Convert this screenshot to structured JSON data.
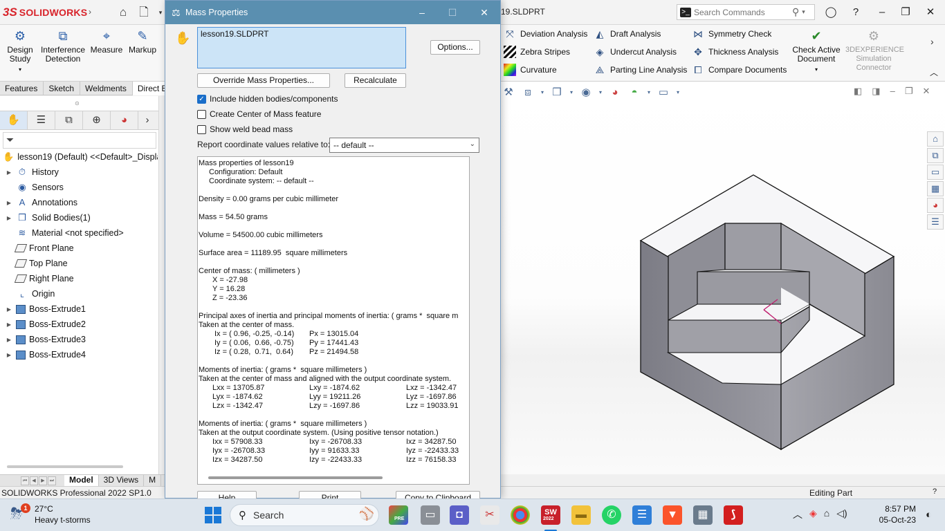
{
  "app": {
    "brand_ds": "3S",
    "brand_name": "SOLIDWORKS",
    "doc_title": "19.SLDPRT",
    "search_placeholder": "Search Commands"
  },
  "command_manager": {
    "big_buttons": [
      {
        "label": "Design\nStudy",
        "icon": "design-study-icon"
      },
      {
        "label": "Interference\nDetection",
        "icon": "interference-icon"
      },
      {
        "label": "Measure",
        "icon": "measure-icon"
      },
      {
        "label": "Markup",
        "icon": "markup-icon"
      }
    ],
    "col1": [
      "Deviation Analysis",
      "Zebra Stripes",
      "Curvature"
    ],
    "col2": [
      "Draft Analysis",
      "Undercut Analysis",
      "Parting Line Analysis"
    ],
    "col3": [
      "Symmetry Check",
      "Thickness Analysis",
      "Compare Documents"
    ],
    "check_active": "Check Active\nDocument",
    "experience": "3DEXPERIENCE\nSimulation\nConnector"
  },
  "cm_tabs": [
    "Features",
    "Sketch",
    "Weldments",
    "Direct E"
  ],
  "feature_tree": {
    "root": "lesson19 (Default) <<Default>_Display",
    "items": [
      {
        "label": "History",
        "expand": true,
        "icon": "history-icon"
      },
      {
        "label": "Sensors",
        "expand": false,
        "icon": "sensors-icon"
      },
      {
        "label": "Annotations",
        "expand": true,
        "icon": "annotations-icon"
      },
      {
        "label": "Solid Bodies(1)",
        "expand": true,
        "icon": "solid-bodies-icon"
      },
      {
        "label": "Material <not specified>",
        "expand": false,
        "icon": "material-icon"
      },
      {
        "label": "Front Plane",
        "expand": false,
        "icon": "plane-icon"
      },
      {
        "label": "Top Plane",
        "expand": false,
        "icon": "plane-icon"
      },
      {
        "label": "Right Plane",
        "expand": false,
        "icon": "plane-icon"
      },
      {
        "label": "Origin",
        "expand": false,
        "icon": "origin-icon"
      },
      {
        "label": "Boss-Extrude1",
        "expand": true,
        "icon": "extrude-icon"
      },
      {
        "label": "Boss-Extrude2",
        "expand": true,
        "icon": "extrude-icon"
      },
      {
        "label": "Boss-Extrude3",
        "expand": true,
        "icon": "extrude-icon"
      },
      {
        "label": "Boss-Extrude4",
        "expand": true,
        "icon": "extrude-icon"
      }
    ]
  },
  "bottom_tabs": [
    "Model",
    "3D Views",
    "M"
  ],
  "status": {
    "left": "SOLIDWORKS Professional 2022 SP1.0",
    "right": "Editing Part"
  },
  "dialog": {
    "title": "Mass Properties",
    "selection": "lesson19.SLDPRT",
    "options_btn": "Options...",
    "override_btn": "Override Mass Properties...",
    "recalc_btn": "Recalculate",
    "checks": [
      {
        "label": "Include hidden bodies/components",
        "checked": true
      },
      {
        "label": "Create Center of Mass feature",
        "checked": false
      },
      {
        "label": "Show weld bead mass",
        "checked": false
      }
    ],
    "coord_label": "Report coordinate values relative to:",
    "coord_value": "-- default --",
    "help_btn": "Help",
    "print_btn": "Print",
    "copy_btn": "Copy to Clipboard",
    "results": {
      "header": "Mass properties of lesson19",
      "config": "Configuration: Default",
      "coord": "Coordinate system: -- default --",
      "density": "Density = 0.00 grams per cubic millimeter",
      "mass": "Mass = 54.50 grams",
      "volume": "Volume = 54500.00 cubic millimeters",
      "surface": "Surface area = 11189.95  square millimeters",
      "com_title": "Center of mass: ( millimeters )",
      "com_x": "X = -27.98",
      "com_y": "Y = 16.28",
      "com_z": "Z = -23.36",
      "pa_title": "Principal axes of inertia and principal moments of inertia: ( grams *  square m",
      "pa_sub": "Taken at the center of mass.",
      "pa_rows": [
        {
          "axis": "Ix = ( 0.96, -0.25, -0.14)",
          "moment": "Px = 13015.04"
        },
        {
          "axis": "Iy = ( 0.06,  0.66, -0.75)",
          "moment": "Py = 17441.43"
        },
        {
          "axis": "Iz = ( 0.28,  0.71,  0.64)",
          "moment": "Pz = 21494.58"
        }
      ],
      "mi1_title": "Moments of inertia: ( grams *  square millimeters )",
      "mi1_sub": "Taken at the center of mass and aligned with the output coordinate system.",
      "mi1_rows": [
        [
          "Lxx = 13705.87",
          "Lxy = -1874.62",
          "Lxz = -1342.47"
        ],
        [
          "Lyx = -1874.62",
          "Lyy = 19211.26",
          "Lyz = -1697.86"
        ],
        [
          "Lzx = -1342.47",
          "Lzy = -1697.86",
          "Lzz = 19033.91"
        ]
      ],
      "mi2_title": "Moments of inertia: ( grams *  square millimeters )",
      "mi2_sub": "Taken at the output coordinate system. (Using positive tensor notation.)",
      "mi2_rows": [
        [
          "Ixx = 57908.33",
          "Ixy = -26708.33",
          "Ixz = 34287.50"
        ],
        [
          "Iyx = -26708.33",
          "Iyy = 91633.33",
          "Iyz = -22433.33"
        ],
        [
          "Izx = 34287.50",
          "Izy = -22433.33",
          "Izz = 76158.33"
        ]
      ]
    }
  },
  "taskbar": {
    "weather_badge": "1",
    "temp": "27°C",
    "weather": "Heavy t-storms",
    "search": "Search",
    "sw_badge": "2022",
    "pre_badge": "PRE",
    "time": "8:57 PM",
    "date": "05-Oct-23"
  },
  "colors": {
    "dialog_title": "#5a8fb0",
    "brand_red": "#d8232a",
    "accent_blue": "#1a6ec9",
    "model_gray": "#8a8a92"
  }
}
